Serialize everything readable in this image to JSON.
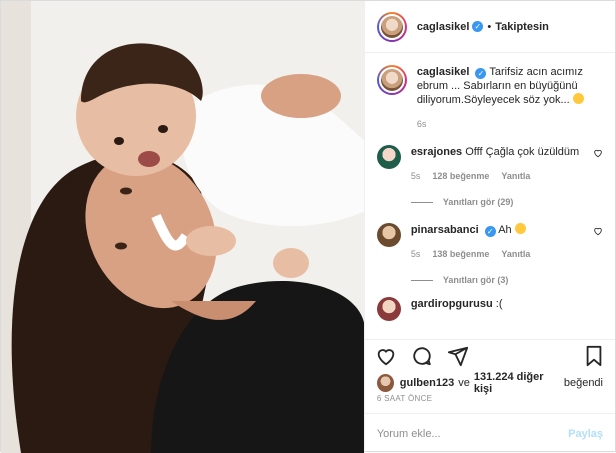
{
  "header": {
    "username": "caglasikel",
    "separator": "•",
    "follow_label": "Takiptesin"
  },
  "caption": {
    "username": "caglasikel",
    "text": "Tarifsiz acın acımız ebrum ... Sabırların en büyüğünü diliyorum.Söyleyecek söz yok...",
    "time": "6s"
  },
  "comments": [
    {
      "username": "esrajones",
      "text": "Offf Çağla çok üzüldüm",
      "time": "5s",
      "likes": "128 beğenme",
      "reply_label": "Yanıtla",
      "view_replies": "Yanıtları gör (29)"
    },
    {
      "username": "pinarsabanci",
      "text": "Ah",
      "time": "5s",
      "likes": "138 beğenme",
      "reply_label": "Yanıtla",
      "view_replies": "Yanıtları gör (3)"
    },
    {
      "username": "gardiropgurusu",
      "text": ":("
    }
  ],
  "likes_line": {
    "user": "gulben123",
    "connector": "ve",
    "count": "131.224 diğer kişi",
    "suffix": "beğendi"
  },
  "time_ago": "6 SAAT ÖNCE",
  "comment_box": {
    "placeholder": "Yorum ekle...",
    "post_label": "Paylaş"
  },
  "icons": [
    "heart-icon",
    "comment-icon",
    "share-icon",
    "bookmark-icon",
    "verified-icon",
    "smile-emoji-icon"
  ],
  "colors": {
    "verified": "#3897f0",
    "post_button_disabled": "#b2dffc",
    "muted_text": "#8e8e8e"
  }
}
